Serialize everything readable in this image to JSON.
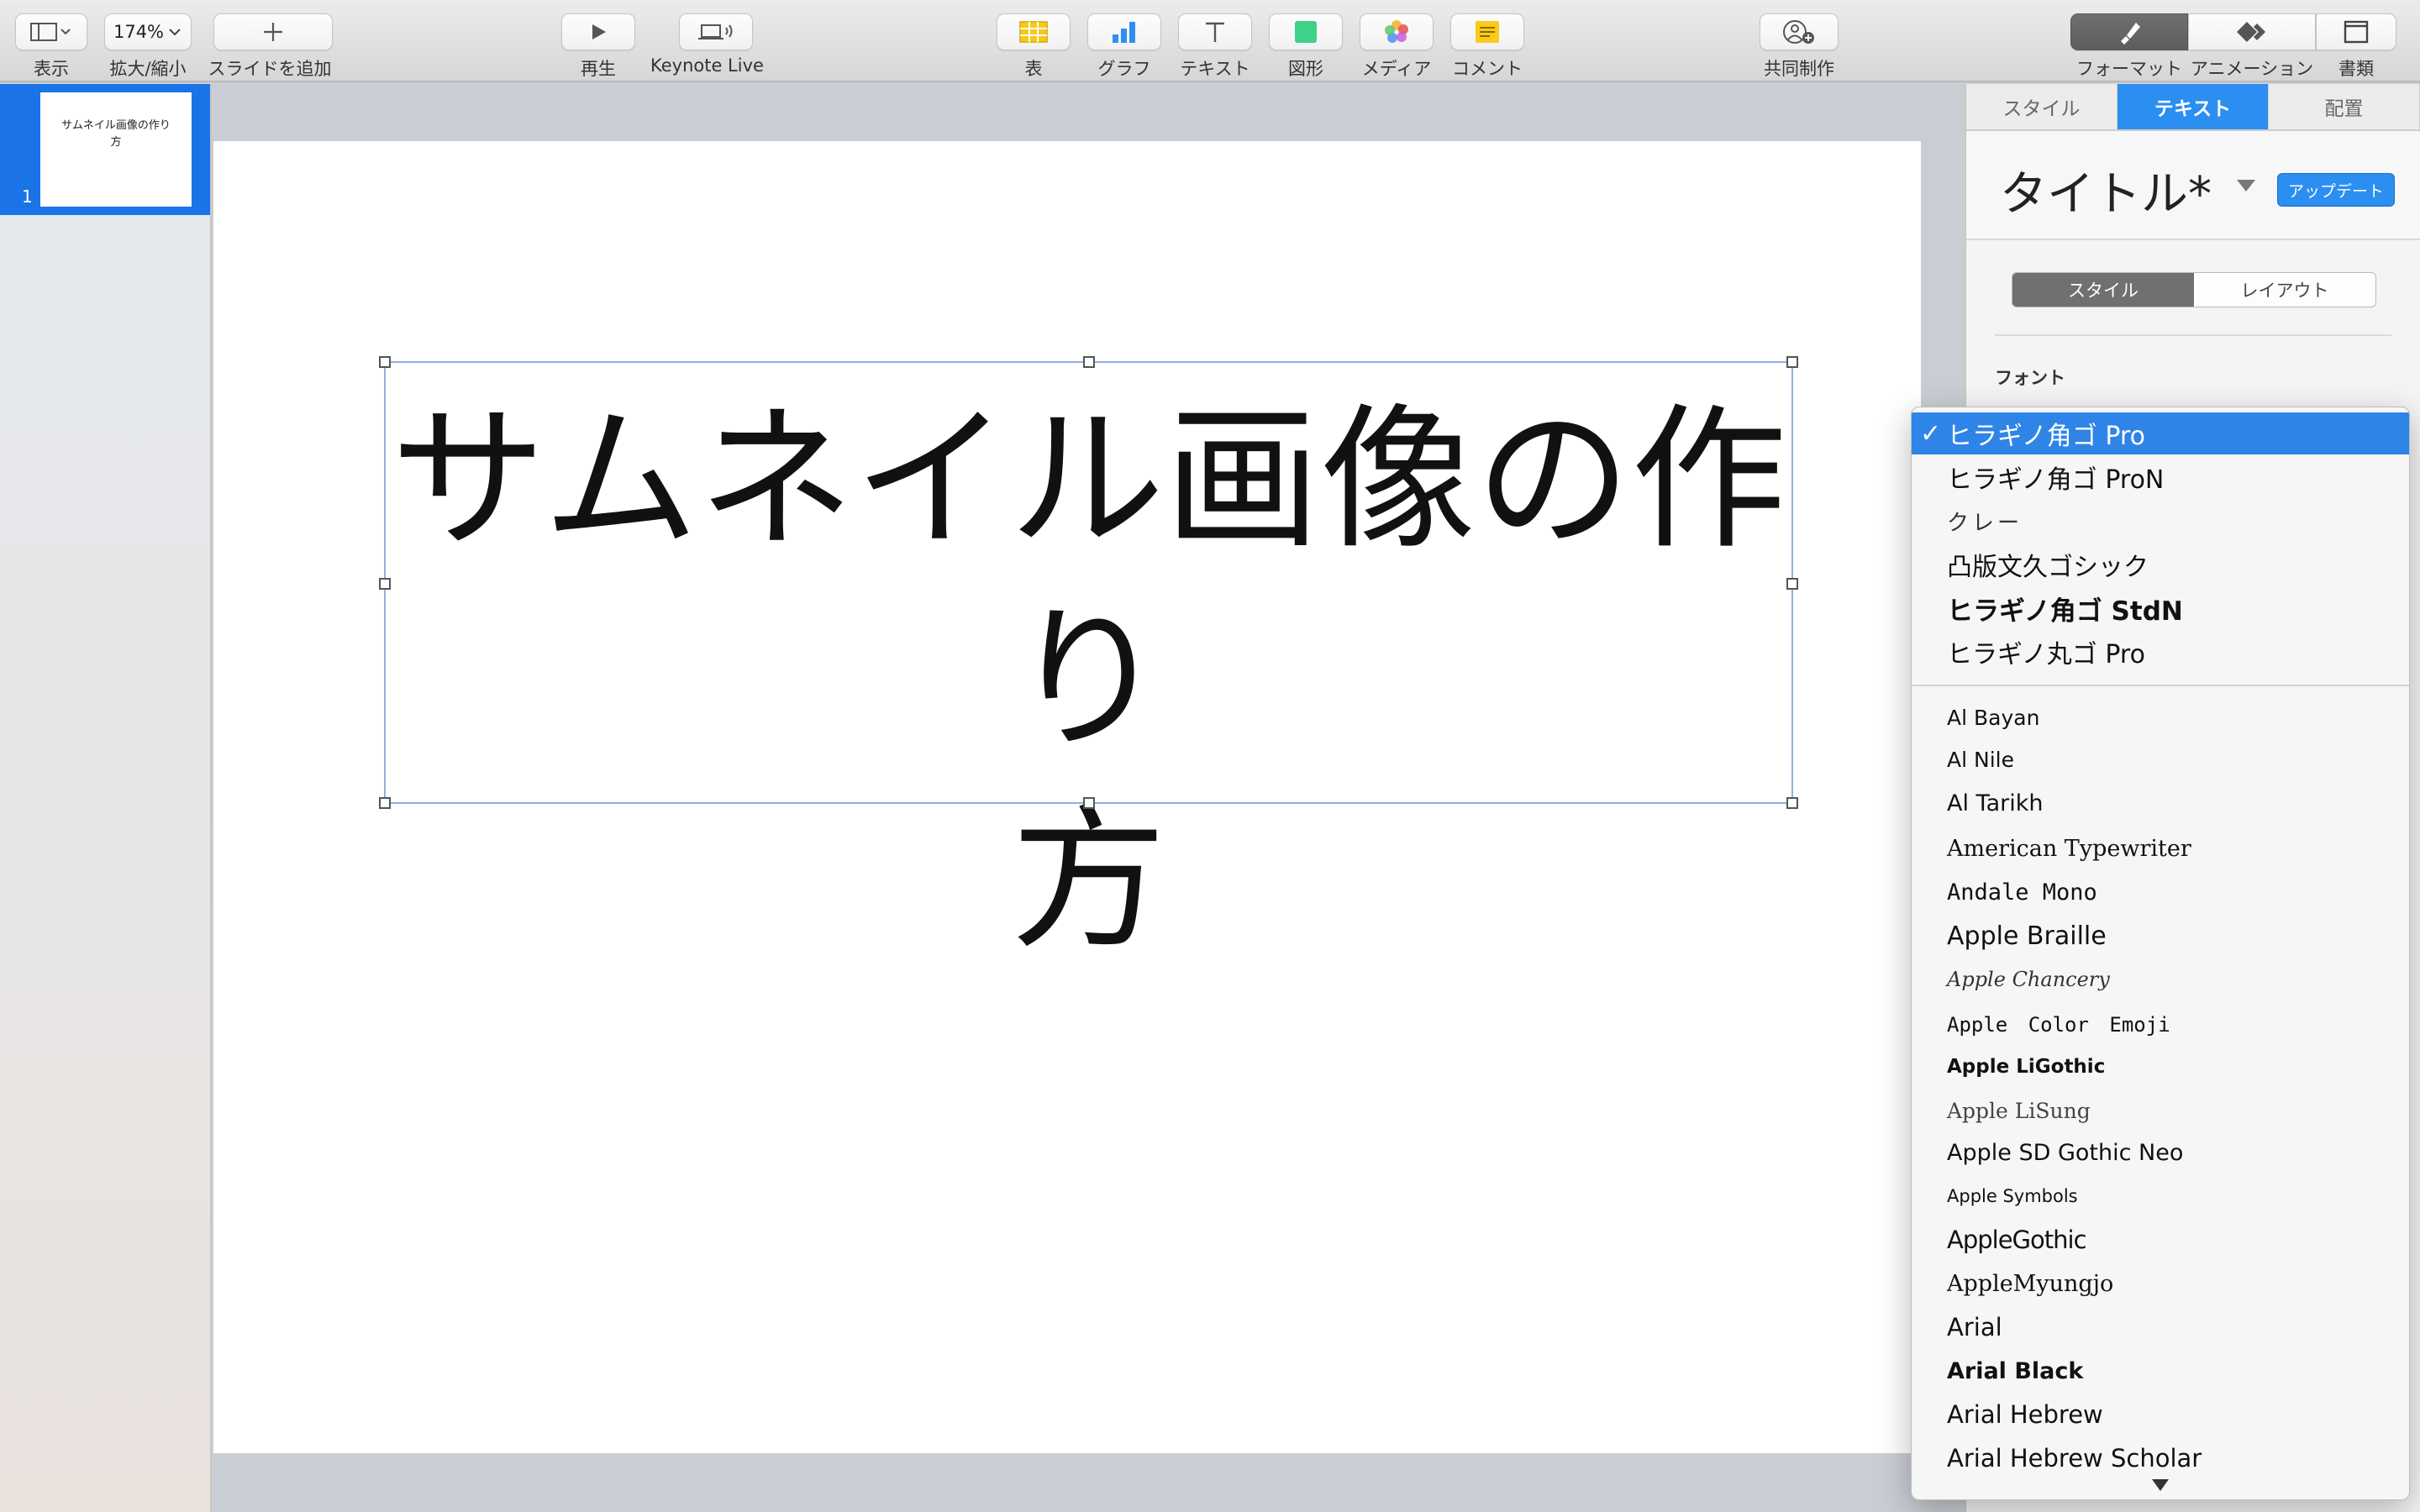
{
  "toolbar": {
    "view": "表示",
    "zoom_value": "174%",
    "zoom": "拡大/縮小",
    "add_slide": "スライドを追加",
    "play": "再生",
    "keynote_live": "Keynote Live",
    "table": "表",
    "chart": "グラフ",
    "text": "テキスト",
    "shape": "図形",
    "media": "メディア",
    "comment": "コメント",
    "collaborate": "共同制作",
    "format": "フォーマット",
    "animate": "アニメーション",
    "document": "書類"
  },
  "sidebar": {
    "slides": [
      {
        "number": "1",
        "thumb_line1": "サムネイル画像の作り",
        "thumb_line2": "方"
      }
    ]
  },
  "slide": {
    "title_line1": "サムネイル画像の作り",
    "title_line2": "方"
  },
  "inspector": {
    "tabs": [
      "スタイル",
      "テキスト",
      "配置"
    ],
    "style_name": "タイトル*",
    "update": "アップデート",
    "segments": [
      "スタイル",
      "レイアウト"
    ],
    "font_label": "フォント"
  },
  "font_menu": {
    "recent": [
      "ヒラギノ角ゴ Pro",
      "ヒラギノ角ゴ ProN",
      "クレー",
      "凸版文久ゴシック",
      "ヒラギノ角ゴ StdN",
      "ヒラギノ丸ゴ Pro"
    ],
    "all": [
      "Al Bayan",
      "Al Nile",
      "Al Tarikh",
      "American Typewriter",
      "Andale Mono",
      "Apple Braille",
      "Apple Chancery",
      "Apple Color Emoji",
      "Apple LiGothic",
      "Apple LiSung",
      "Apple SD Gothic Neo",
      "Apple Symbols",
      "AppleGothic",
      "AppleMyungjo",
      "Arial",
      "Arial Black",
      "Arial Hebrew",
      "Arial Hebrew Scholar"
    ]
  },
  "colors": {
    "accent": "#2b8ef0",
    "selection": "#2f84e8",
    "slide_selected": "#1a74e8"
  }
}
